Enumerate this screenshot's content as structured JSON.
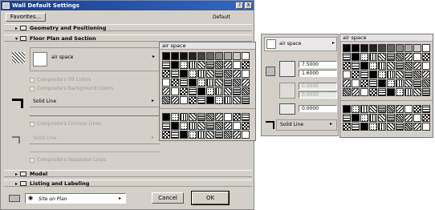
{
  "window": {
    "title": "Wall Default Settings",
    "help_btn": "?",
    "close_btn": "X"
  },
  "toolbar": {
    "favorites_label": "Favorites...",
    "default_label": "Default"
  },
  "sections": {
    "geometry": "Geometry and Positioning",
    "floor_plan": "Floor Plan and Section",
    "model": "Model",
    "listing": "Listing and Labeling"
  },
  "fill": {
    "value": "air space"
  },
  "checkboxes": {
    "fill_colors": "Composite's Fill Colors",
    "bg_colors": "Composite's Background Colors",
    "contour_lines": "Composite's Contour Lines",
    "separator_lines": "Composite's Separator Lines"
  },
  "lines": {
    "solid_line": "Solid Line",
    "solid_line_disabled": "Solid Line"
  },
  "footer": {
    "layer_value": "Site on Plan",
    "cancel_label": "Cancel",
    "ok_label": "OK"
  },
  "palette": {
    "title": "air space",
    "title_right": "air space"
  },
  "right_panel": {
    "fill_label": "air space",
    "value1": "7.5000",
    "value2": "1.6000",
    "value3": "0.0000",
    "value4": "0.0000",
    "value5": "0.0000",
    "line_label": "Solid Line"
  },
  "colors": {
    "titlebar": "#1a3f8a",
    "face": "#d4d0c8",
    "field": "#ffffff"
  }
}
